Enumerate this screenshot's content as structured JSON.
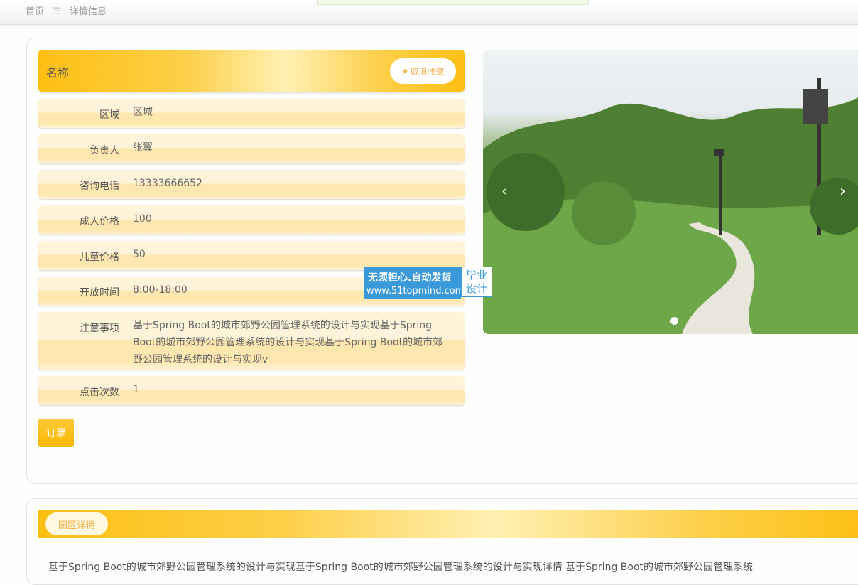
{
  "breadcrumb": {
    "home": "首页",
    "separator": "☰",
    "current": "详情信息"
  },
  "detail": {
    "name": "名称",
    "favorite_label": "取消收藏",
    "fields": [
      {
        "label": "区域",
        "value": "区域"
      },
      {
        "label": "负责人",
        "value": "张翼"
      },
      {
        "label": "咨询电话",
        "value": "13333666652"
      },
      {
        "label": "成人价格",
        "value": "100"
      },
      {
        "label": "儿童价格",
        "value": "50"
      },
      {
        "label": "开放时间",
        "value": "8:00-18:00"
      },
      {
        "label": "注意事项",
        "value": "基于Spring Boot的城市郊野公园管理系统的设计与实现基于Spring Boot的城市郊野公园管理系统的设计与实现基于Spring Boot的城市郊野公园管理系统的设计与实现v"
      },
      {
        "label": "点击次数",
        "value": "1"
      }
    ],
    "order_button": "订票"
  },
  "carousel": {
    "prev": "‹",
    "next": "›"
  },
  "watermark": {
    "line1": "无须担心.自动发货",
    "line2": "www.51topmind.com",
    "side": "毕业 设计"
  },
  "park_detail": {
    "tab": "园区详情",
    "text": "基于Spring Boot的城市郊野公园管理系统的设计与实现基于Spring Boot的城市郊野公园管理系统的设计与实现详情 基于Spring Boot的城市郊野公园管理系统"
  },
  "colors": {
    "accent": "#fdbf12",
    "accent_light": "#fff0b3",
    "fav_text": "#f2b24c",
    "watermark_blue": "#3a9ad9"
  }
}
